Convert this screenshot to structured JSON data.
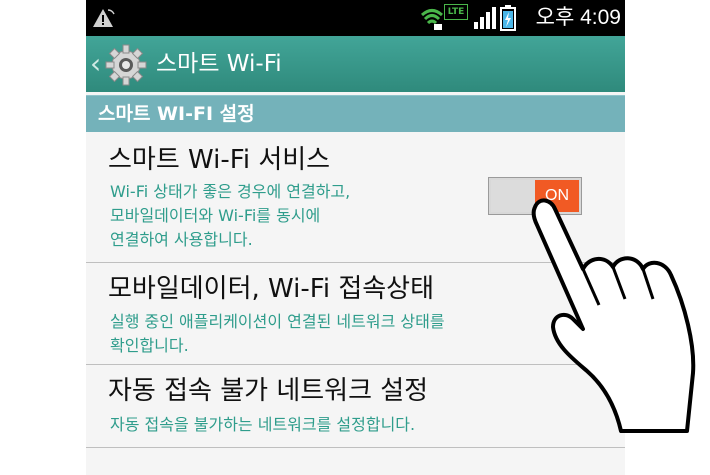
{
  "status_bar": {
    "time": "오후 4:09",
    "lte": "LTE",
    "icons": [
      "warning-icon",
      "wifi-icon",
      "signal-icon",
      "battery-icon"
    ]
  },
  "action_bar": {
    "title": "스마트 Wi-Fi",
    "icon": "gear-icon",
    "color": "#3a9a8d"
  },
  "section": {
    "title": "스마트 WI-FI 설정",
    "color": "#74b2ba"
  },
  "items": [
    {
      "title": "스마트 Wi-Fi 서비스",
      "subtitle_lines": [
        "Wi-Fi 상태가 좋은 경우에 연결하고,",
        "모바일데이터와 Wi-Fi를 동시에",
        "연결하여 사용합니다."
      ],
      "toggle": {
        "state_label": "ON",
        "on_color": "#f15a24"
      }
    },
    {
      "title": "모바일데이터, Wi-Fi 접속상태",
      "subtitle_lines": [
        "실행 중인 애플리케이션이 연결된 네트워크 상태를",
        "확인합니다."
      ]
    },
    {
      "title": "자동 접속 불가 네트워크 설정",
      "subtitle_lines": [
        "자동 접속을 불가하는 네트워크를 설정합니다."
      ]
    }
  ],
  "subtitle_color": "#2f9d8c"
}
